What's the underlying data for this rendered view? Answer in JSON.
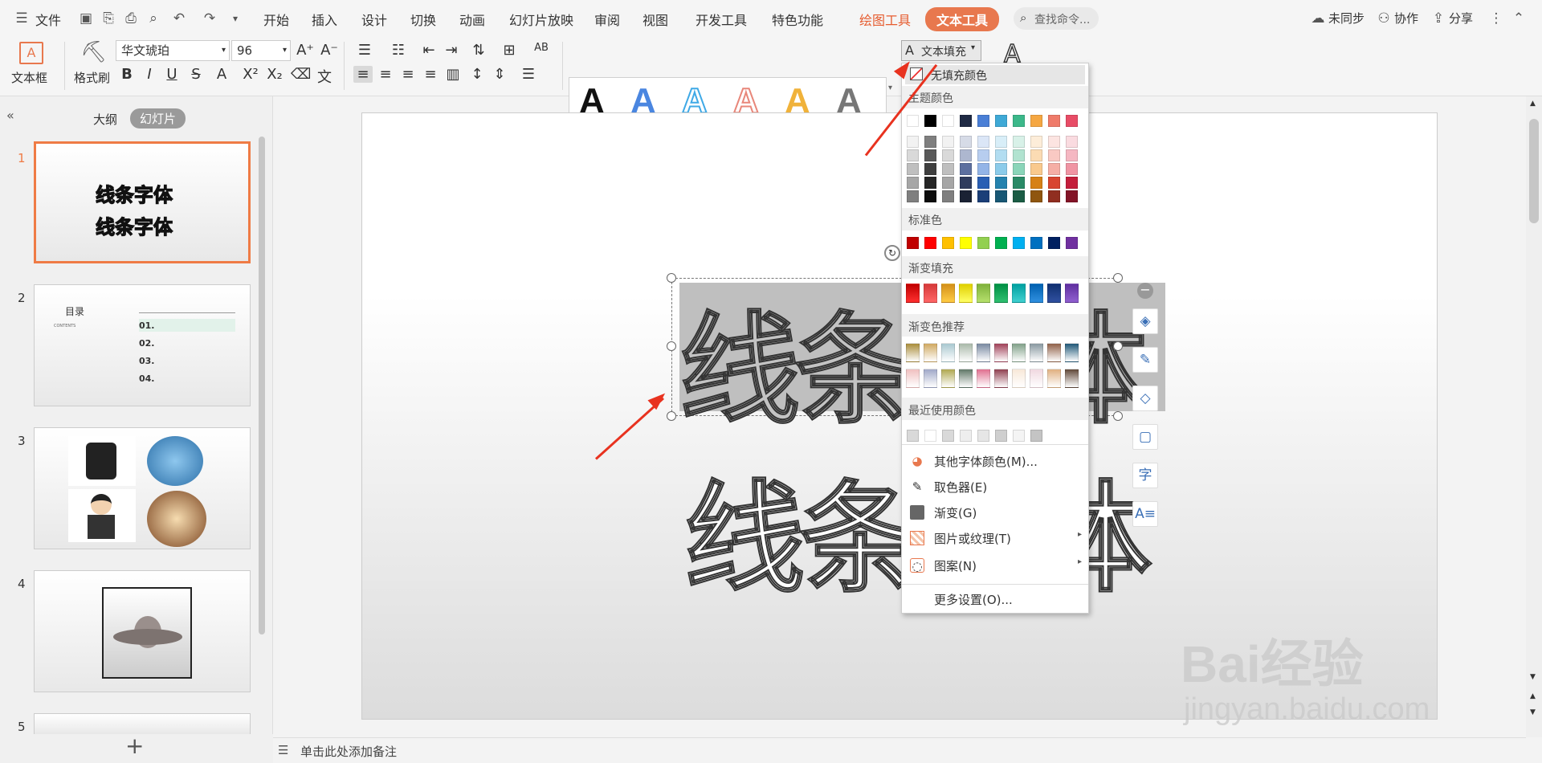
{
  "menubar": {
    "file": "文件",
    "tabs": [
      "开始",
      "插入",
      "设计",
      "切换",
      "动画",
      "幻灯片放映",
      "审阅",
      "视图",
      "开发工具",
      "特色功能"
    ],
    "draw_tools": "绘图工具",
    "text_tools": "文本工具",
    "search_placeholder": "查找命令...",
    "unsynced": "未同步",
    "collab": "协作",
    "share": "分享"
  },
  "ribbon": {
    "textbox": "文本框",
    "format_painter": "格式刷",
    "font_name": "华文琥珀",
    "font_size": "96",
    "text_fill": "文本填充",
    "wordart_letter": "A"
  },
  "panel": {
    "tab_outline": "大纲",
    "tab_slides": "幻灯片",
    "slides": [
      {
        "num": "1",
        "line1": "线条字体",
        "line2": "线条字体"
      },
      {
        "num": "2",
        "title": "目录",
        "sub": "CONTENTS",
        "items": [
          "01.",
          "02.",
          "03.",
          "04."
        ]
      },
      {
        "num": "3"
      },
      {
        "num": "4"
      },
      {
        "num": "5"
      }
    ],
    "add": "+"
  },
  "canvas": {
    "text_top": "线条字体",
    "text_bottom": "线条字体"
  },
  "notes": "单击此处添加备注",
  "dropdown": {
    "no_fill": "无填充颜色",
    "theme": "主题颜色",
    "standard": "标准色",
    "gradient": "渐变填充",
    "gradient_rec": "渐变色推荐",
    "recent": "最近使用颜色",
    "more_colors": "其他字体颜色(M)...",
    "eyedropper": "取色器(E)",
    "gradient_item": "渐变(G)",
    "picture": "图片或纹理(T)",
    "pattern": "图案(N)",
    "more_settings": "更多设置(O)...",
    "theme_row": [
      "#ffffff",
      "#000000",
      "#ffffff",
      "#1f2a44",
      "#4a7fd6",
      "#3fa9d6",
      "#3cb88a",
      "#f5a742",
      "#ef7b6a",
      "#e84c66"
    ],
    "standard_row": [
      "#c00000",
      "#ff0000",
      "#ffc000",
      "#ffff00",
      "#92d050",
      "#00b050",
      "#00b0f0",
      "#0070c0",
      "#002060",
      "#7030a0"
    ]
  },
  "watermark": {
    "brand": "Bai经验",
    "url": "jingyan.baidu.com"
  }
}
